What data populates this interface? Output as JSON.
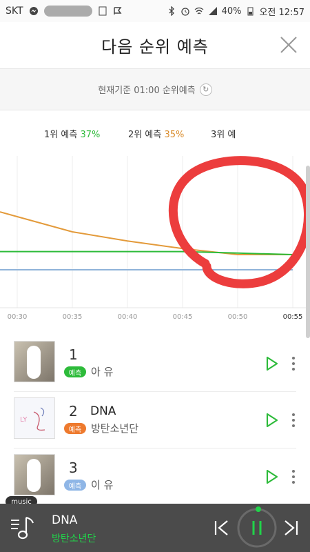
{
  "statusbar": {
    "carrier": "SKT",
    "battery": "40%",
    "time": "오전 12:57"
  },
  "header": {
    "title": "다음 순위 예측"
  },
  "basis": {
    "text": "현재기준 01:00 순위예측"
  },
  "legend": [
    {
      "label": "1위 예측",
      "value": "37%",
      "color": "#2dbb3a"
    },
    {
      "label": "2위 예측",
      "value": "35%",
      "color": "#e39a3a"
    },
    {
      "label": "3위 예",
      "value": "",
      "color": "#6aa4e0"
    }
  ],
  "chart_data": {
    "type": "line",
    "x": [
      "00:30",
      "00:35",
      "00:40",
      "00:45",
      "00:50",
      "00:55"
    ],
    "series": [
      {
        "color": "#e39a3a",
        "values": [
          60,
          50,
          44,
          39,
          35,
          35
        ]
      },
      {
        "color": "#2dbb3a",
        "values": [
          37,
          37,
          37,
          37,
          36,
          35
        ]
      },
      {
        "color": "#8fb3d9",
        "values": [
          25,
          25,
          25,
          25,
          25,
          25
        ]
      }
    ],
    "ylim": [
      0,
      100
    ],
    "grid": true
  },
  "songs": [
    {
      "rank": "1",
      "title": "",
      "badge": "예측",
      "badge_color": "#2dbb3a",
      "artist": "아  유"
    },
    {
      "rank": "2",
      "title": "DNA",
      "badge": "예측",
      "badge_color": "#ee7a2e",
      "artist": "방탄소년단"
    },
    {
      "rank": "3",
      "title": "",
      "badge": "예측",
      "badge_color": "#8fb6e6",
      "artist": "이  유"
    }
  ],
  "player": {
    "tag": "music",
    "title": "DNA",
    "artist": "방탄소년단"
  },
  "colors": {
    "accent_green": "#21d34a",
    "player_bg": "#4b4b4b"
  }
}
